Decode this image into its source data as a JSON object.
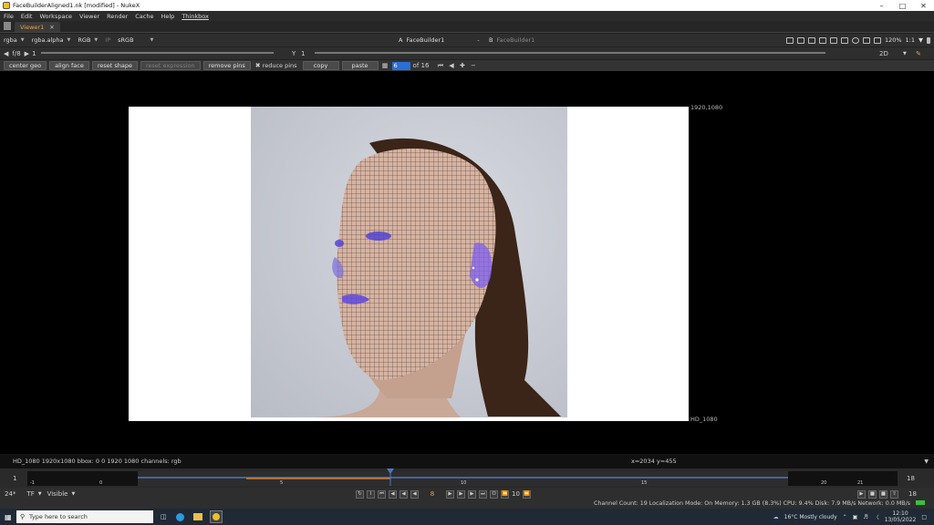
{
  "window": {
    "title": "FaceBuilderAligned1.nk [modified] - NukeX"
  },
  "menu": [
    "File",
    "Edit",
    "Workspace",
    "Viewer",
    "Render",
    "Cache",
    "Help",
    "Thinkbox"
  ],
  "tabs": [
    {
      "label": "Viewer1"
    }
  ],
  "viewer_controls": {
    "channels": "rgba",
    "alpha": "rgba.alpha",
    "display": "RGB",
    "ip": "IP",
    "lut": "sRGB",
    "input_a_letter": "A",
    "input_a": "FaceBuilder1",
    "input_a_sep": "-",
    "input_b_letter": "B",
    "input_b": "FaceBuilder1",
    "zoom": "120%",
    "ratio": "1:1",
    "fstop": "f/8",
    "frame_gain": "1",
    "gamma_label": "Y",
    "gamma": "1",
    "view_mode": "2D"
  },
  "toolbar": {
    "center_geo": "center geo",
    "align_face": "align face",
    "reset_shape": "reset shape",
    "reset_expression": "reset expression",
    "remove_pins": "remove pins",
    "reduce_pins": "reduce pins",
    "copy": "copy",
    "paste": "paste",
    "keyframe_current": "6",
    "keyframe_total": "of 16"
  },
  "viewer": {
    "format_top_right": "1920,1080",
    "format_bottom_right": "HD_1080"
  },
  "status": {
    "info": "HD_1080 1920x1080  bbox: 0 0 1920 1080 channels: rgb",
    "coords": "x=2034 y=455"
  },
  "timeline": {
    "start_frame": "1",
    "end_frame": "18",
    "current_frame": "8",
    "ticks": [
      "-1",
      "0",
      "5",
      "10",
      "15",
      "20",
      "21"
    ],
    "fps": "24*",
    "tf": "TF",
    "visible": "Visible",
    "step": "10",
    "playback_end": "18"
  },
  "system_info": "Channel Count: 19  Localization Mode: On  Memory: 1.3 GB (8.3%)  CPU: 9.4%  Disk: 7.9 MB/s  Network: 0.0 MB/s",
  "taskbar": {
    "search_placeholder": "Type here to search",
    "weather": "16°C  Mostly cloudy",
    "time": "12:10",
    "date": "13/05/2022"
  }
}
